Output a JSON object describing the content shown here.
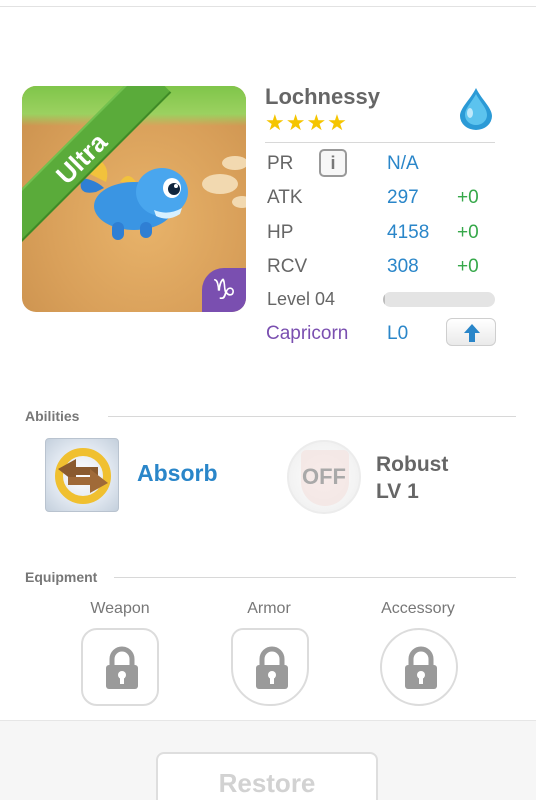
{
  "monster": {
    "name": "Lochnessy",
    "rank_badge": "Ultra",
    "stars": "★★★★",
    "element_icon": "water-drop-icon",
    "sign_glyph": "♑"
  },
  "stats": {
    "pr": {
      "label": "PR",
      "value": "N/A"
    },
    "atk": {
      "label": "ATK",
      "value": "297",
      "bonus": "+0"
    },
    "hp": {
      "label": "HP",
      "value": "4158",
      "bonus": "+0"
    },
    "rcv": {
      "label": "RCV",
      "value": "308",
      "bonus": "+0"
    },
    "level": {
      "label": "Level 04",
      "progress": 0.02
    },
    "sign": {
      "label": "Capricorn",
      "level": "L0"
    }
  },
  "abilities": {
    "title": "Abilities",
    "active": {
      "name": "Absorb",
      "icon": "absorb-arrows-icon"
    },
    "passive": {
      "status": "OFF",
      "name_line1": "Robust",
      "name_line2": "LV 1"
    }
  },
  "equipment": {
    "title": "Equipment",
    "slots": [
      {
        "label": "Weapon",
        "icon": "lock-icon"
      },
      {
        "label": "Armor",
        "icon": "lock-icon"
      },
      {
        "label": "Accessory",
        "icon": "lock-icon"
      }
    ]
  },
  "actions": {
    "restore_label": "Restore"
  },
  "colors": {
    "accent_blue": "#2a86c9",
    "bonus_green": "#36a84a",
    "star_gold": "#f5c500",
    "sign_purple": "#7a4fb0",
    "ribbon_green": "#5aab3a"
  }
}
